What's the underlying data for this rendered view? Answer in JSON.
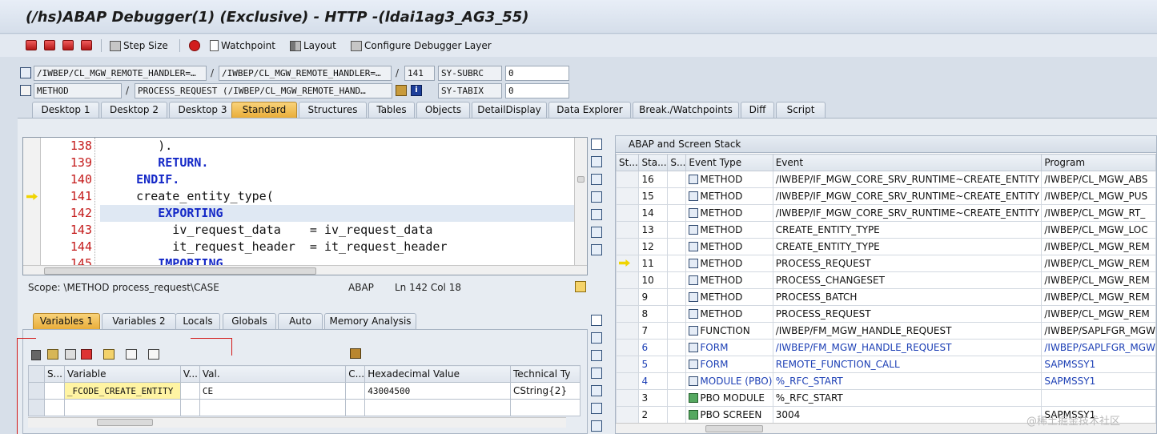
{
  "window": {
    "title": "(/hs)ABAP Debugger(1)  (Exclusive) - HTTP -(ldai1ag3_AG3_55)"
  },
  "toolbar": {
    "step_size": "Step Size",
    "watchpoint": "Watchpoint",
    "layout": "Layout",
    "configure": "Configure Debugger Layer"
  },
  "location": {
    "program1": "/IWBEP/CL_MGW_REMOTE_HANDLER=…",
    "program2": "/IWBEP/CL_MGW_REMOTE_HANDLER=…",
    "line": "141",
    "sysvar1_name": "SY-SUBRC",
    "sysvar1_value": "0",
    "event_type": "METHOD",
    "event_name": "PROCESS_REQUEST (/IWBEP/CL_MGW_REMOTE_HAND…",
    "sysvar2_name": "SY-TABIX",
    "sysvar2_value": "0",
    "separator": "/"
  },
  "main_tabs": [
    "Desktop 1",
    "Desktop 2",
    "Desktop 3",
    "Standard",
    "Structures",
    "Tables",
    "Objects",
    "DetailDisplay",
    "Data Explorer",
    "Break./Watchpoints",
    "Diff",
    "Script"
  ],
  "source": {
    "lines": [
      {
        "num": "138",
        "code": "        )."
      },
      {
        "num": "139",
        "code": "        RETURN."
      },
      {
        "num": "140",
        "code": "     ENDIF."
      },
      {
        "num": "141",
        "code": "     create_entity_type("
      },
      {
        "num": "142",
        "code": "        EXPORTING"
      },
      {
        "num": "143",
        "code": "          iv_request_data    = iv_request_data"
      },
      {
        "num": "144",
        "code": "          it_request_header  = it_request_header"
      },
      {
        "num": "145",
        "code": "        IMPORTING"
      }
    ],
    "scope": "Scope: \\METHOD process_request\\CASE",
    "language": "ABAP",
    "position": "Ln 142 Col  18"
  },
  "variables": {
    "tabs": [
      "Variables 1",
      "Variables 2",
      "Locals",
      "Globals",
      "Auto",
      "Memory Analysis"
    ],
    "columns": [
      "S...",
      "Variable",
      "V...",
      "Val.",
      "C...",
      "Hexadecimal Value",
      "Technical Ty"
    ],
    "rows": [
      {
        "variable": "_FCODE_CREATE_ENTITY",
        "value": "CE",
        "hex": "43004500",
        "type": "CString{2}"
      }
    ]
  },
  "stack": {
    "title": "ABAP and Screen Stack",
    "columns": [
      "St...",
      "Sta...",
      "S...",
      "Event Type",
      "Event",
      "Program"
    ],
    "rows": [
      {
        "level": "16",
        "type": "METHOD",
        "event": "/IWBEP/IF_MGW_CORE_SRV_RUNTIME~CREATE_ENTITY",
        "program": "/IWBEP/CL_MGW_ABS"
      },
      {
        "level": "15",
        "type": "METHOD",
        "event": "/IWBEP/IF_MGW_CORE_SRV_RUNTIME~CREATE_ENTITY",
        "program": "/IWBEP/CL_MGW_PUS"
      },
      {
        "level": "14",
        "type": "METHOD",
        "event": "/IWBEP/IF_MGW_CORE_SRV_RUNTIME~CREATE_ENTITY",
        "program": "/IWBEP/CL_MGW_RT_"
      },
      {
        "level": "13",
        "type": "METHOD",
        "event": "CREATE_ENTITY_TYPE",
        "program": "/IWBEP/CL_MGW_LOC"
      },
      {
        "level": "12",
        "type": "METHOD",
        "event": "CREATE_ENTITY_TYPE",
        "program": "/IWBEP/CL_MGW_REM"
      },
      {
        "level": "11",
        "type": "METHOD",
        "event": "PROCESS_REQUEST",
        "program": "/IWBEP/CL_MGW_REM"
      },
      {
        "level": "10",
        "type": "METHOD",
        "event": "PROCESS_CHANGESET",
        "program": "/IWBEP/CL_MGW_REM"
      },
      {
        "level": "9",
        "type": "METHOD",
        "event": "PROCESS_BATCH",
        "program": "/IWBEP/CL_MGW_REM"
      },
      {
        "level": "8",
        "type": "METHOD",
        "event": "PROCESS_REQUEST",
        "program": "/IWBEP/CL_MGW_REM"
      },
      {
        "level": "7",
        "type": "FUNCTION",
        "event": "/IWBEP/FM_MGW_HANDLE_REQUEST",
        "program": "/IWBEP/SAPLFGR_MGW"
      },
      {
        "level": "6",
        "type": "FORM",
        "event": "/IWBEP/FM_MGW_HANDLE_REQUEST",
        "program": "/IWBEP/SAPLFGR_MGW"
      },
      {
        "level": "5",
        "type": "FORM",
        "event": "REMOTE_FUNCTION_CALL",
        "program": "SAPMSSY1"
      },
      {
        "level": "4",
        "type": "MODULE (PBO)",
        "event": "%_RFC_START",
        "program": "SAPMSSY1"
      },
      {
        "level": "3",
        "type": "PBO MODULE",
        "event": "%_RFC_START",
        "program": ""
      },
      {
        "level": "2",
        "type": "PBO SCREEN",
        "event": "3004",
        "program": "SAPMSSY1"
      }
    ]
  },
  "watermark": "@稀土掘金技术社区",
  "colors": {
    "active_tab": "#e9ad3a",
    "keyword": "#1428c7",
    "line_number": "#c41b1b",
    "blue_row": "#1c3fb5"
  }
}
